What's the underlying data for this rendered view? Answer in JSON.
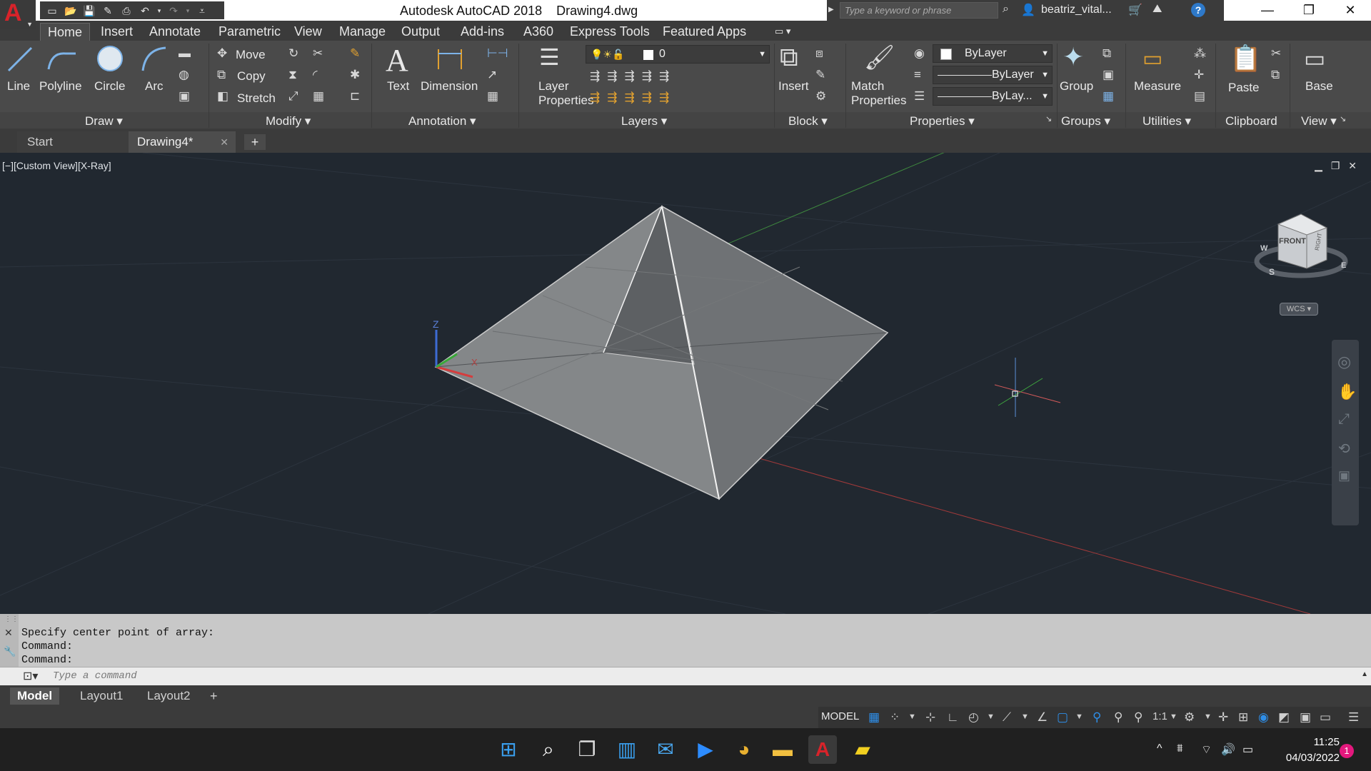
{
  "app": {
    "logo_letter": "A",
    "title_app": "Autodesk AutoCAD 2018",
    "title_file": "Drawing4.dwg",
    "search_placeholder": "Type a keyword or phrase",
    "user": "beatriz_vital...",
    "accent": "#d8232a"
  },
  "ribbon_tabs": [
    "Home",
    "Insert",
    "Annotate",
    "Parametric",
    "View",
    "Manage",
    "Output",
    "Add-ins",
    "A360",
    "Express Tools",
    "Featured Apps"
  ],
  "ribbon": {
    "draw": {
      "line": "Line",
      "polyline": "Polyline",
      "circle": "Circle",
      "arc": "Arc",
      "title": "Draw"
    },
    "modify": {
      "move": "Move",
      "copy": "Copy",
      "stretch": "Stretch",
      "title": "Modify"
    },
    "annotation": {
      "text": "Text",
      "dimension": "Dimension",
      "title": "Annotation"
    },
    "layers": {
      "layer_properties_1": "Layer",
      "layer_properties_2": "Properties",
      "current_layer": "0",
      "title": "Layers"
    },
    "block": {
      "insert": "Insert",
      "title": "Block"
    },
    "properties": {
      "match_1": "Match",
      "match_2": "Properties",
      "color": "ByLayer",
      "linetype": "ByLayer",
      "lineweight": "ByLay...",
      "title": "Properties"
    },
    "groups": {
      "group": "Group",
      "title": "Groups"
    },
    "utilities": {
      "measure": "Measure",
      "title": "Utilities"
    },
    "clipboard": {
      "paste": "Paste",
      "title": "Clipboard"
    },
    "view": {
      "base": "Base",
      "title": "View"
    }
  },
  "doc_tabs": [
    {
      "label": "Start"
    },
    {
      "label": "Drawing4*"
    }
  ],
  "viewport": {
    "label": "[−][Custom View][X-Ray]",
    "wcs": "WCS",
    "viewcube_front": "FRONT",
    "viewcube_right": "RIGHT",
    "compass_s": "S",
    "compass_w": "W",
    "compass_e": "E",
    "axis_z": "Z",
    "axis_x": "X"
  },
  "command": {
    "history": [
      "Specify center point of array:",
      "Command:",
      "Command:"
    ],
    "placeholder": "Type a command"
  },
  "layout_tabs": [
    "Model",
    "Layout1",
    "Layout2"
  ],
  "status": {
    "model": "MODEL",
    "scale": "1:1"
  },
  "clock": {
    "time": "11:25",
    "date": "04/03/2022",
    "notifications": "1"
  }
}
